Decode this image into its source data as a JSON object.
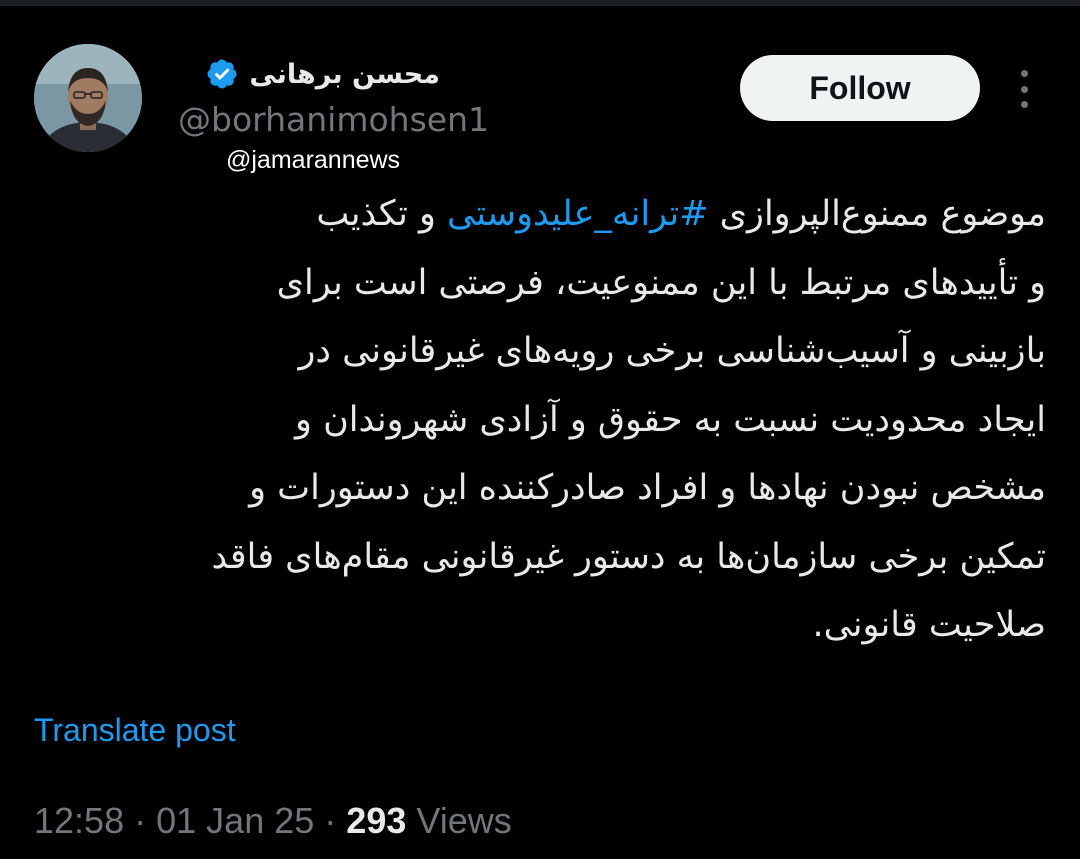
{
  "author": {
    "display_name": "محسن برهانی",
    "handle": "@borhanimohsen1",
    "verified": true,
    "avatar_icon": "profile-photo"
  },
  "watermark": "@jamarannews",
  "follow_label": "Follow",
  "more_icon": "more-options-icon",
  "tweet": {
    "lines": [
      {
        "before": "موضوع ممنوع‌الپروازی ",
        "hashtag": "#ترانه_علیدوستی",
        "after": " و تکذیب"
      },
      {
        "text": "و تأییدهای مرتبط با این ممنوعیت، فرصتی است برای"
      },
      {
        "text": "بازبینی و آسیب‌شناسی برخی رویه‌های غیرقانونی در"
      },
      {
        "text": "ایجاد محدودیت نسبت به حقوق و آزادی شهروندان و"
      },
      {
        "text": "مشخص نبودن نهادها و افراد صادرکننده این دستورات و"
      },
      {
        "text": "تمکین برخی سازمان‌ها به دستور غیرقانونی مقام‌های فاقد"
      },
      {
        "text": "صلاحیت قانونی."
      }
    ]
  },
  "translate_label": "Translate post",
  "meta": {
    "time": "12:58",
    "date": "01 Jan 25",
    "separator": "·",
    "views_count": "293",
    "views_label": "Views"
  },
  "colors": {
    "background": "#000000",
    "text": "#e7e9ea",
    "secondary_text": "#71767b",
    "link": "#1d9bf0",
    "follow_bg": "#eff3f4",
    "verified_badge": "#1d9bf0"
  }
}
